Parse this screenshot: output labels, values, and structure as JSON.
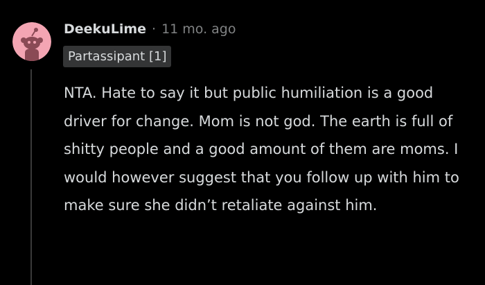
{
  "comment": {
    "username": "DeekuLime",
    "separator": "·",
    "timestamp": "11 mo. ago",
    "flair": "Partassipant [1]",
    "body": "NTA. Hate to say it but public humiliation is a good driver for change. Mom is not god. The earth is full of shitty people and a good amount of them are moms. I would however suggest that you follow up with him to make sure she didn’t retaliate against him.",
    "avatar_icon": "snoo-avatar-icon"
  },
  "colors": {
    "background": "#000000",
    "avatar_bg": "#f3a5b3",
    "text_primary": "#d7dadc",
    "text_muted": "#818384",
    "flair_bg": "#343536",
    "thread_line": "#3a3a3a"
  }
}
